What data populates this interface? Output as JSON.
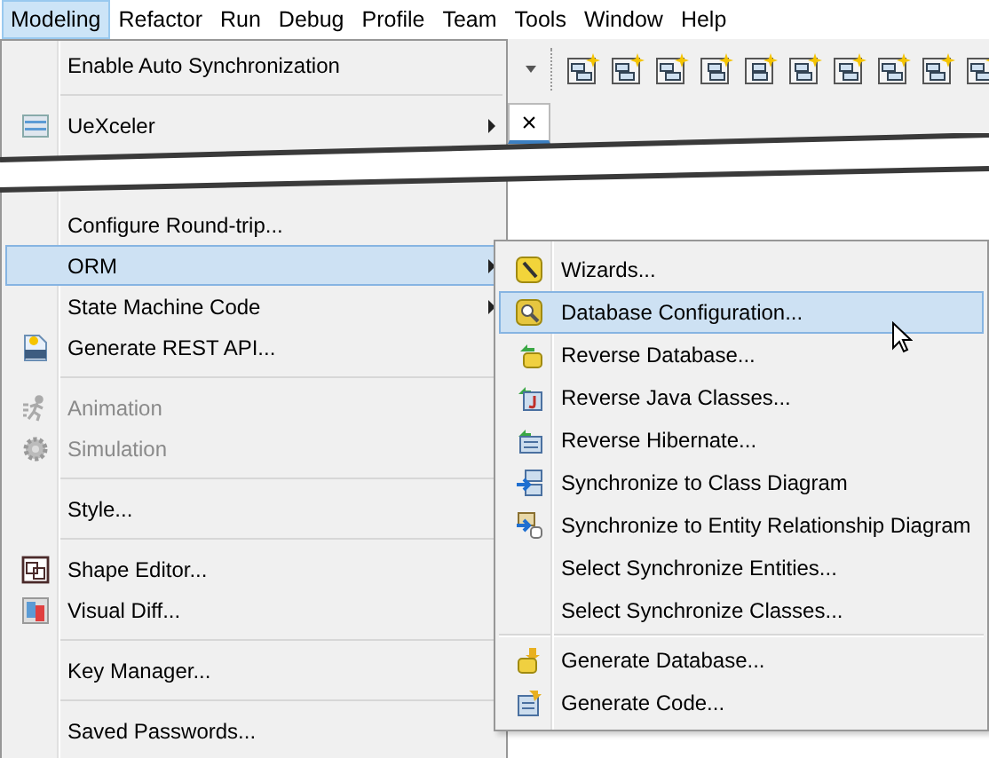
{
  "menubar": [
    {
      "label": "Modeling",
      "selected": true
    },
    {
      "label": "Refactor",
      "selected": false
    },
    {
      "label": "Run",
      "selected": false
    },
    {
      "label": "Debug",
      "selected": false
    },
    {
      "label": "Profile",
      "selected": false
    },
    {
      "label": "Team",
      "selected": false
    },
    {
      "label": "Tools",
      "selected": false
    },
    {
      "label": "Window",
      "selected": false
    },
    {
      "label": "Help",
      "selected": false
    }
  ],
  "editor_tab": {
    "close": "×"
  },
  "main_menu": {
    "sections_before_break": [
      [
        {
          "label": "Enable Auto Synchronization",
          "submenu": false,
          "selected": false,
          "disabled": false
        }
      ],
      [
        {
          "label": "UeXceler",
          "submenu": true,
          "selected": false,
          "disabled": false
        }
      ]
    ],
    "sections_after_break": [
      [
        {
          "label": "Configure Round-trip...",
          "submenu": false,
          "selected": false,
          "disabled": false
        },
        {
          "label": "ORM",
          "submenu": true,
          "selected": true,
          "disabled": false
        },
        {
          "label": "State Machine Code",
          "submenu": true,
          "selected": false,
          "disabled": false
        },
        {
          "label": "Generate REST API...",
          "submenu": false,
          "selected": false,
          "disabled": false
        }
      ],
      [
        {
          "label": "Animation",
          "submenu": false,
          "selected": false,
          "disabled": true
        },
        {
          "label": "Simulation",
          "submenu": false,
          "selected": false,
          "disabled": true
        }
      ],
      [
        {
          "label": "Style...",
          "submenu": false,
          "selected": false,
          "disabled": false
        }
      ],
      [
        {
          "label": "Shape Editor...",
          "submenu": false,
          "selected": false,
          "disabled": false
        },
        {
          "label": "Visual Diff...",
          "submenu": false,
          "selected": false,
          "disabled": false
        }
      ],
      [
        {
          "label": "Key Manager...",
          "submenu": false,
          "selected": false,
          "disabled": false
        }
      ],
      [
        {
          "label": "Saved Passwords...",
          "submenu": false,
          "selected": false,
          "disabled": false
        }
      ]
    ]
  },
  "orm_submenu": {
    "sections": [
      [
        {
          "label": "Wizards...",
          "selected": false
        },
        {
          "label": "Database Configuration...",
          "selected": true
        },
        {
          "label": "Reverse Database...",
          "selected": false
        },
        {
          "label": "Reverse Java Classes...",
          "selected": false
        },
        {
          "label": "Reverse Hibernate...",
          "selected": false
        },
        {
          "label": "Synchronize to Class Diagram",
          "selected": false
        },
        {
          "label": "Synchronize to Entity Relationship Diagram",
          "selected": false
        },
        {
          "label": "Select Synchronize Entities...",
          "selected": false
        },
        {
          "label": "Select Synchronize Classes...",
          "selected": false
        }
      ],
      [
        {
          "label": "Generate Database...",
          "selected": false
        },
        {
          "label": "Generate Code...",
          "selected": false
        }
      ]
    ]
  }
}
